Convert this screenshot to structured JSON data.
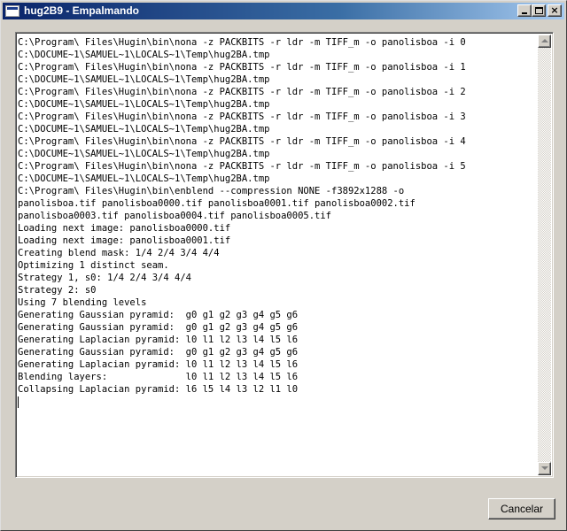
{
  "window": {
    "title": "hug2B9 - Empalmando",
    "controls": {
      "minimize_icon": "minimize-icon",
      "maximize_icon": "maximize-icon",
      "close_icon": "close-icon",
      "close_glyph": "×"
    }
  },
  "console": {
    "lines": [
      "C:\\Program\\ Files\\Hugin\\bin\\nona -z PACKBITS -r ldr -m TIFF_m -o panolisboa -i 0",
      "C:\\DOCUME~1\\SAMUEL~1\\LOCALS~1\\Temp\\hug2BA.tmp",
      "C:\\Program\\ Files\\Hugin\\bin\\nona -z PACKBITS -r ldr -m TIFF_m -o panolisboa -i 1",
      "C:\\DOCUME~1\\SAMUEL~1\\LOCALS~1\\Temp\\hug2BA.tmp",
      "C:\\Program\\ Files\\Hugin\\bin\\nona -z PACKBITS -r ldr -m TIFF_m -o panolisboa -i 2",
      "C:\\DOCUME~1\\SAMUEL~1\\LOCALS~1\\Temp\\hug2BA.tmp",
      "C:\\Program\\ Files\\Hugin\\bin\\nona -z PACKBITS -r ldr -m TIFF_m -o panolisboa -i 3",
      "C:\\DOCUME~1\\SAMUEL~1\\LOCALS~1\\Temp\\hug2BA.tmp",
      "C:\\Program\\ Files\\Hugin\\bin\\nona -z PACKBITS -r ldr -m TIFF_m -o panolisboa -i 4",
      "C:\\DOCUME~1\\SAMUEL~1\\LOCALS~1\\Temp\\hug2BA.tmp",
      "C:\\Program\\ Files\\Hugin\\bin\\nona -z PACKBITS -r ldr -m TIFF_m -o panolisboa -i 5",
      "C:\\DOCUME~1\\SAMUEL~1\\LOCALS~1\\Temp\\hug2BA.tmp",
      "C:\\Program\\ Files\\Hugin\\bin\\enblend --compression NONE -f3892x1288 -o",
      "panolisboa.tif panolisboa0000.tif panolisboa0001.tif panolisboa0002.tif",
      "panolisboa0003.tif panolisboa0004.tif panolisboa0005.tif",
      "Loading next image: panolisboa0000.tif",
      "Loading next image: panolisboa0001.tif",
      "Creating blend mask: 1/4 2/4 3/4 4/4",
      "Optimizing 1 distinct seam.",
      "Strategy 1, s0: 1/4 2/4 3/4 4/4",
      "Strategy 2: s0",
      "Using 7 blending levels",
      "Generating Gaussian pyramid:  g0 g1 g2 g3 g4 g5 g6",
      "Generating Gaussian pyramid:  g0 g1 g2 g3 g4 g5 g6",
      "Generating Laplacian pyramid: l0 l1 l2 l3 l4 l5 l6",
      "Generating Gaussian pyramid:  g0 g1 g2 g3 g4 g5 g6",
      "Generating Laplacian pyramid: l0 l1 l2 l3 l4 l5 l6",
      "Blending layers:              l0 l1 l2 l3 l4 l5 l6",
      "Collapsing Laplacian pyramid: l6 l5 l4 l3 l2 l1 l0"
    ]
  },
  "scrollbar": {
    "up_icon": "scroll-up-arrow-icon",
    "down_icon": "scroll-down-arrow-icon"
  },
  "footer": {
    "cancel_label": "Cancelar"
  },
  "colors": {
    "title_start": "#0a246a",
    "title_end": "#a6caf0",
    "face": "#d4d0c8"
  }
}
